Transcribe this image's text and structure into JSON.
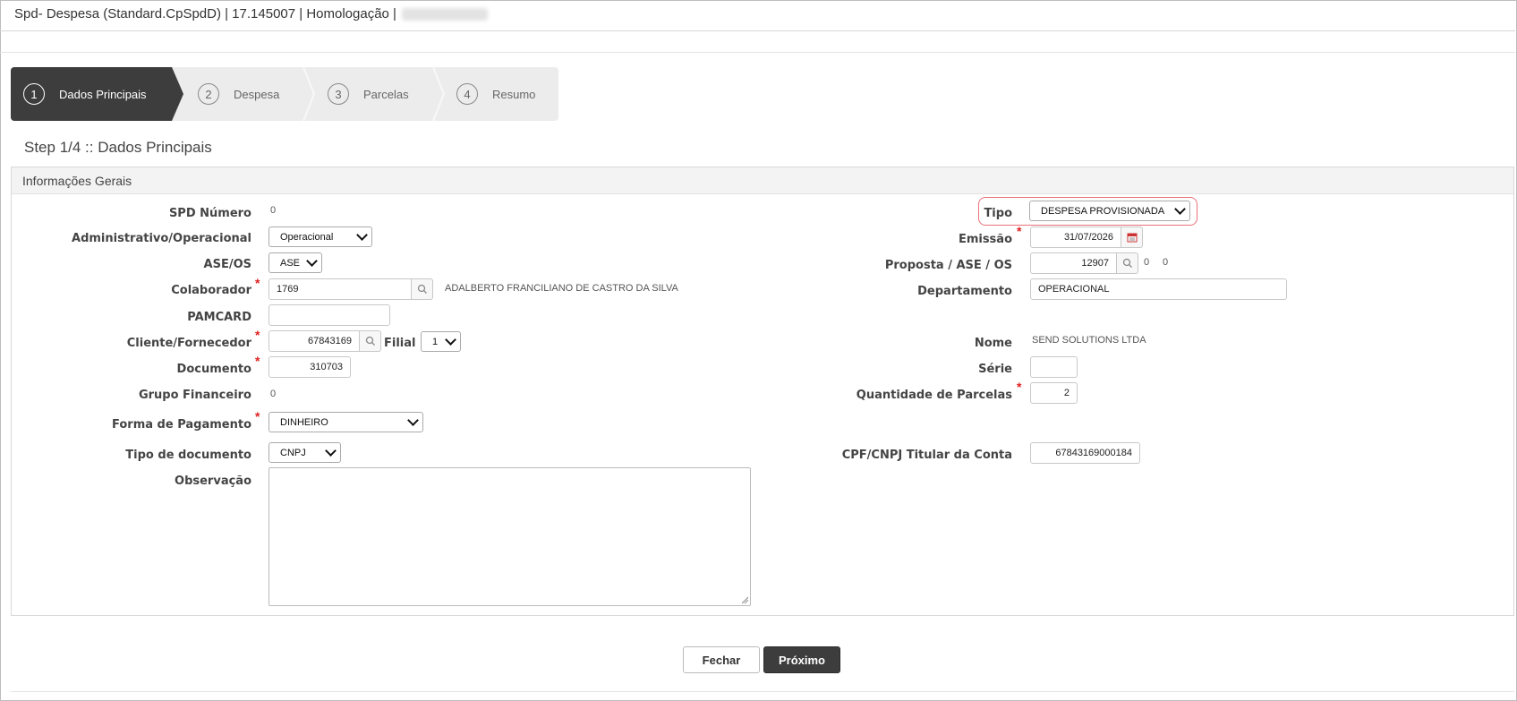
{
  "window": {
    "title": "Spd- Despesa (Standard.CpSpdD) | 17.145007 | Homologação |"
  },
  "wizard": {
    "steps": [
      {
        "num": "1",
        "label": "Dados Principais"
      },
      {
        "num": "2",
        "label": "Despesa"
      },
      {
        "num": "3",
        "label": "Parcelas"
      },
      {
        "num": "4",
        "label": "Resumo"
      }
    ],
    "active_step": 1
  },
  "step_title": "Step 1/4 :: Dados Principais",
  "section": {
    "title": "Informações Gerais"
  },
  "left": {
    "spd_numero": {
      "label": "SPD Número",
      "value": "0"
    },
    "adm_oper": {
      "label": "Administrativo/Operacional",
      "value": "Operacional"
    },
    "ase_os": {
      "label": "ASE/OS",
      "value": "ASE"
    },
    "colaborador": {
      "label": "Colaborador",
      "value": "1769",
      "name": "ADALBERTO FRANCILIANO DE CASTRO DA SILVA"
    },
    "pamcard": {
      "label": "PAMCARD",
      "value": ""
    },
    "cliente": {
      "label": "Cliente/Fornecedor",
      "value": "67843169",
      "filial_label": "Filial",
      "filial_value": "1"
    },
    "documento": {
      "label": "Documento",
      "value": "310703"
    },
    "grupo_financeiro": {
      "label": "Grupo Financeiro",
      "value": "0"
    },
    "forma_pagamento": {
      "label": "Forma de Pagamento",
      "value": "DINHEIRO"
    },
    "tipo_documento": {
      "label": "Tipo de documento",
      "value": "CNPJ"
    },
    "observacao": {
      "label": "Observação",
      "value": ""
    }
  },
  "right": {
    "tipo": {
      "label": "Tipo",
      "value": "DESPESA PROVISIONADA"
    },
    "emissao": {
      "label": "Emissão",
      "value": "31/07/2026"
    },
    "proposta": {
      "label": "Proposta / ASE / OS",
      "value": "12907",
      "extra1": "0",
      "extra2": "0"
    },
    "departamento": {
      "label": "Departamento",
      "value": "OPERACIONAL"
    },
    "nome": {
      "label": "Nome",
      "value": "SEND SOLUTIONS LTDA"
    },
    "serie": {
      "label": "Série",
      "value": ""
    },
    "qtd_parcelas": {
      "label": "Quantidade de Parcelas",
      "value": "2"
    },
    "cpf_cnpj": {
      "label": "CPF/CNPJ Titular da Conta",
      "value": "67843169000184"
    }
  },
  "buttons": {
    "fechar": "Fechar",
    "proximo": "Próximo"
  },
  "colors": {
    "accent_dark": "#3d3d3d",
    "required": "#e02020",
    "highlight": "#e8727a"
  }
}
